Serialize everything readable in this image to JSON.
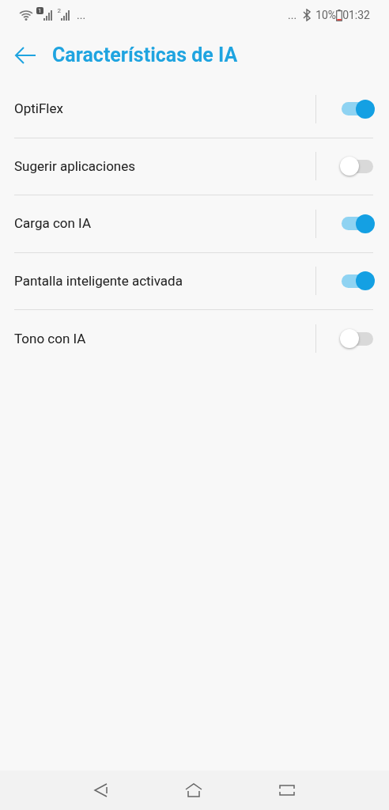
{
  "status_bar": {
    "sim_1": "1",
    "sim_2": "2",
    "left_more": "...",
    "right_more": "...",
    "battery": "10%",
    "time": "01:32"
  },
  "header": {
    "title": "Características de IA"
  },
  "settings": [
    {
      "label": "OptiFlex",
      "on": true
    },
    {
      "label": "Sugerir aplicaciones",
      "on": false
    },
    {
      "label": "Carga con IA",
      "on": true
    },
    {
      "label": "Pantalla inteligente activada",
      "on": true
    },
    {
      "label": "Tono con IA",
      "on": false
    }
  ]
}
